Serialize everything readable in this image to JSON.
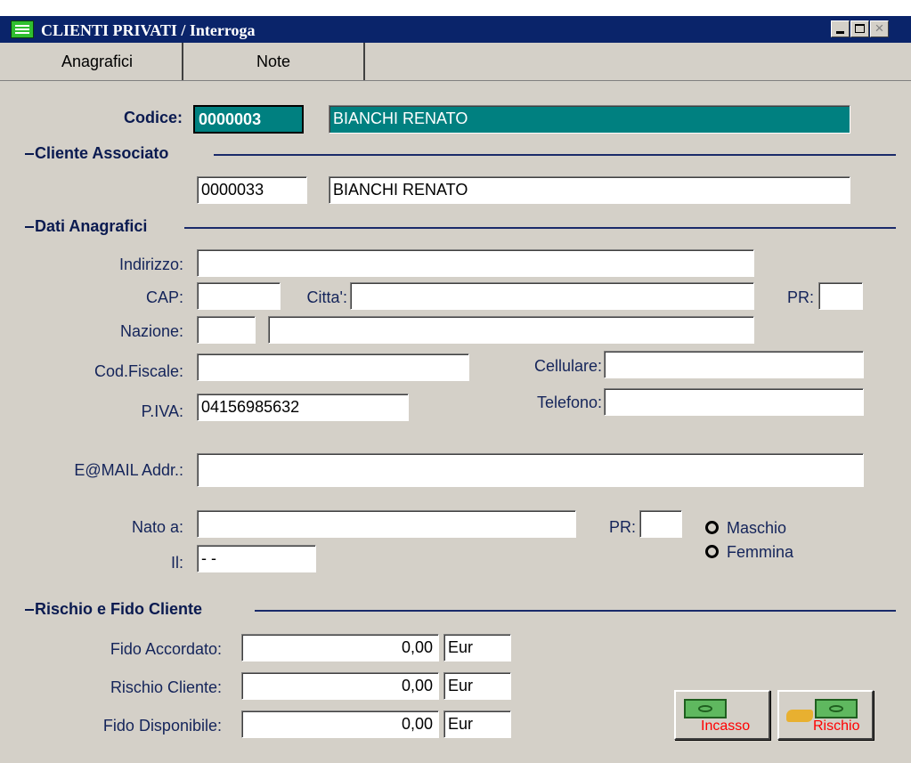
{
  "window": {
    "title": "CLIENTI PRIVATI / Interroga",
    "minimize_icon": "minimize-icon",
    "maximize_icon": "maximize-icon",
    "close_icon": "close-icon",
    "close_glyph": "×"
  },
  "tabs": [
    {
      "label": "Anagrafici",
      "active": true
    },
    {
      "label": "Note",
      "active": false
    }
  ],
  "header": {
    "codice_label": "Codice:",
    "codice_value": "0000003",
    "name_value": "BIANCHI RENATO"
  },
  "cliente_associato": {
    "title": "Cliente Associato",
    "code": "0000033",
    "name": "BIANCHI RENATO"
  },
  "anagrafici": {
    "title": "Dati Anagrafici",
    "indirizzo_label": "Indirizzo:",
    "indirizzo": "",
    "cap_label": "CAP:",
    "cap": "",
    "citta_label": "Citta':",
    "citta": "",
    "pr_label": "PR:",
    "pr": "",
    "nazione_label": "Nazione:",
    "nazione_code": "",
    "nazione_name": "",
    "codfiscale_label": "Cod.Fiscale:",
    "codfiscale": "",
    "cellulare_label": "Cellulare:",
    "cellulare": "",
    "piva_label": "P.IVA:",
    "piva": "04156985632",
    "telefono_label": "Telefono:",
    "telefono": "",
    "email_label": "E@MAIL Addr.:",
    "email": "",
    "nato_label": "Nato a:",
    "nato": "",
    "pr2_label": "PR:",
    "pr2": "",
    "il_label": "Il:",
    "il": " -  - ",
    "sex_options": [
      "Maschio",
      "Femmina"
    ]
  },
  "rischio": {
    "title": "Rischio e Fido Cliente",
    "rows": [
      {
        "label": "Fido Accordato:",
        "value": "0,00",
        "currency": "Eur"
      },
      {
        "label": "Rischio Cliente:",
        "value": "0,00",
        "currency": "Eur"
      },
      {
        "label": "Fido Disponibile:",
        "value": "0,00",
        "currency": "Eur"
      }
    ]
  },
  "buttons": {
    "incasso": "Incasso",
    "rischio": "Rischio"
  },
  "colors": {
    "titlebar": "#0a246a",
    "window_bg": "#d4d0c8",
    "highlight_field": "#008080",
    "label_text": "#14245a",
    "button_text": "#ff0000"
  }
}
